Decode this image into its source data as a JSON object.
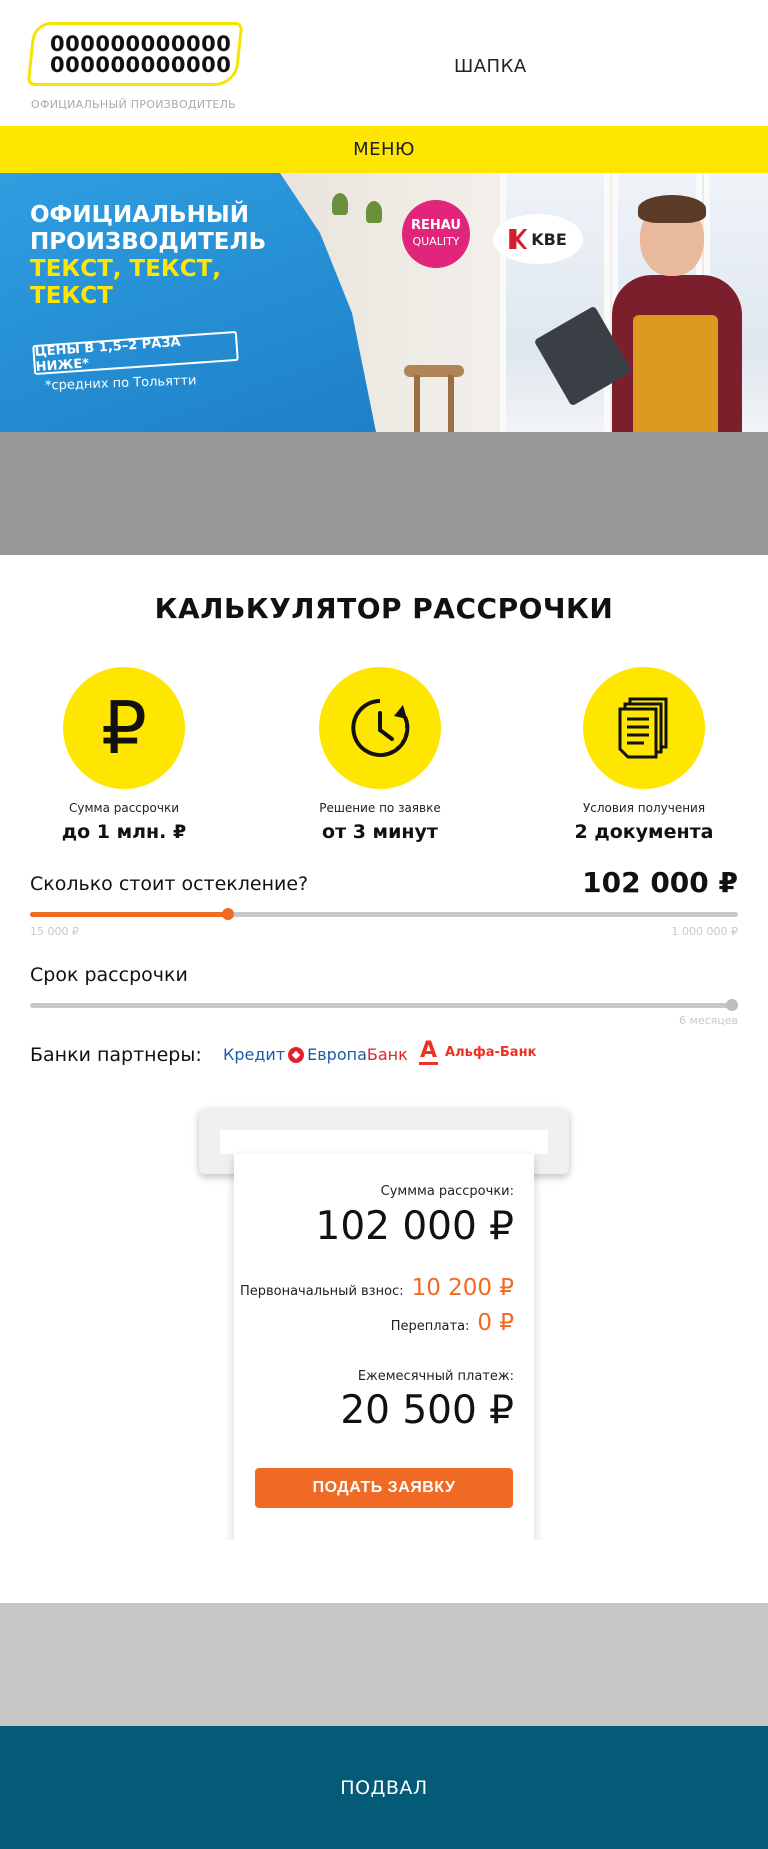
{
  "header": {
    "logo_line1": "000000000000",
    "logo_line2": "000000000000",
    "logo_subtitle": "ОФИЦИАЛЬНЫЙ ПРОИЗВОДИТЕЛЬ",
    "title": "ШАПКА"
  },
  "menu": {
    "label": "МЕНЮ"
  },
  "banner": {
    "line1": "ОФИЦИАЛЬНЫЙ",
    "line2": "ПРОИЗВОДИТЕЛЬ",
    "line3": "ТЕКСТ, ТЕКСТ,",
    "line4": "ТЕКСТ",
    "price_tag": "ЦЕНЫ В 1,5–2 РАЗА НИЖЕ*",
    "price_note": "*средних по Тольятти",
    "rehau_top": "REHAU",
    "rehau_bottom": "QUALITY",
    "kbe": "KBE",
    "colors": {
      "blue": "#1d7fc8",
      "yellow": "#ffe600",
      "rehau_pink": "#e0257a"
    }
  },
  "calculator": {
    "title": "КАЛЬКУЛЯТОР РАССРОЧКИ",
    "features": [
      {
        "icon": "ruble-icon",
        "symbol": "₽",
        "label": "Сумма рассрочки",
        "value": "до 1 млн. ₽"
      },
      {
        "icon": "clock-icon",
        "label": "Решение по заявке",
        "value": "от 3 минут"
      },
      {
        "icon": "documents-icon",
        "label": "Условия получения",
        "value": "2 документа"
      }
    ],
    "cost": {
      "question": "Сколько стоит остекление?",
      "amount": "102 000 ₽",
      "min_label": "15 000 ₽",
      "max_label": "1 000 000 ₽",
      "min": 15000,
      "max": 1000000,
      "value": 102000
    },
    "term": {
      "label": "Срок рассрочки",
      "max_label": "6 месяцев",
      "fill_fraction": 1.0
    },
    "banks": {
      "label": "Банки партнеры:",
      "bank1_part1": "Кредит",
      "bank1_part2": "Европа",
      "bank1_part3": "Банк",
      "bank2_letter": "А",
      "bank2_name": "Альфа-Банк"
    },
    "receipt": {
      "sum_label": "Суммма рассрочки:",
      "sum_value": "102 000 ₽",
      "initial_label": "Первоначальный взнос:",
      "initial_value": "10 200 ₽",
      "overpay_label": "Переплата:",
      "overpay_value": "0 ₽",
      "monthly_label": "Ежемесячный платеж:",
      "monthly_value": "20 500 ₽",
      "submit": "ПОДАТЬ ЗАЯВКУ"
    },
    "accent_color": "#ef6a24"
  },
  "footer": {
    "label": "ПОДВАЛ",
    "color": "#035b78"
  }
}
